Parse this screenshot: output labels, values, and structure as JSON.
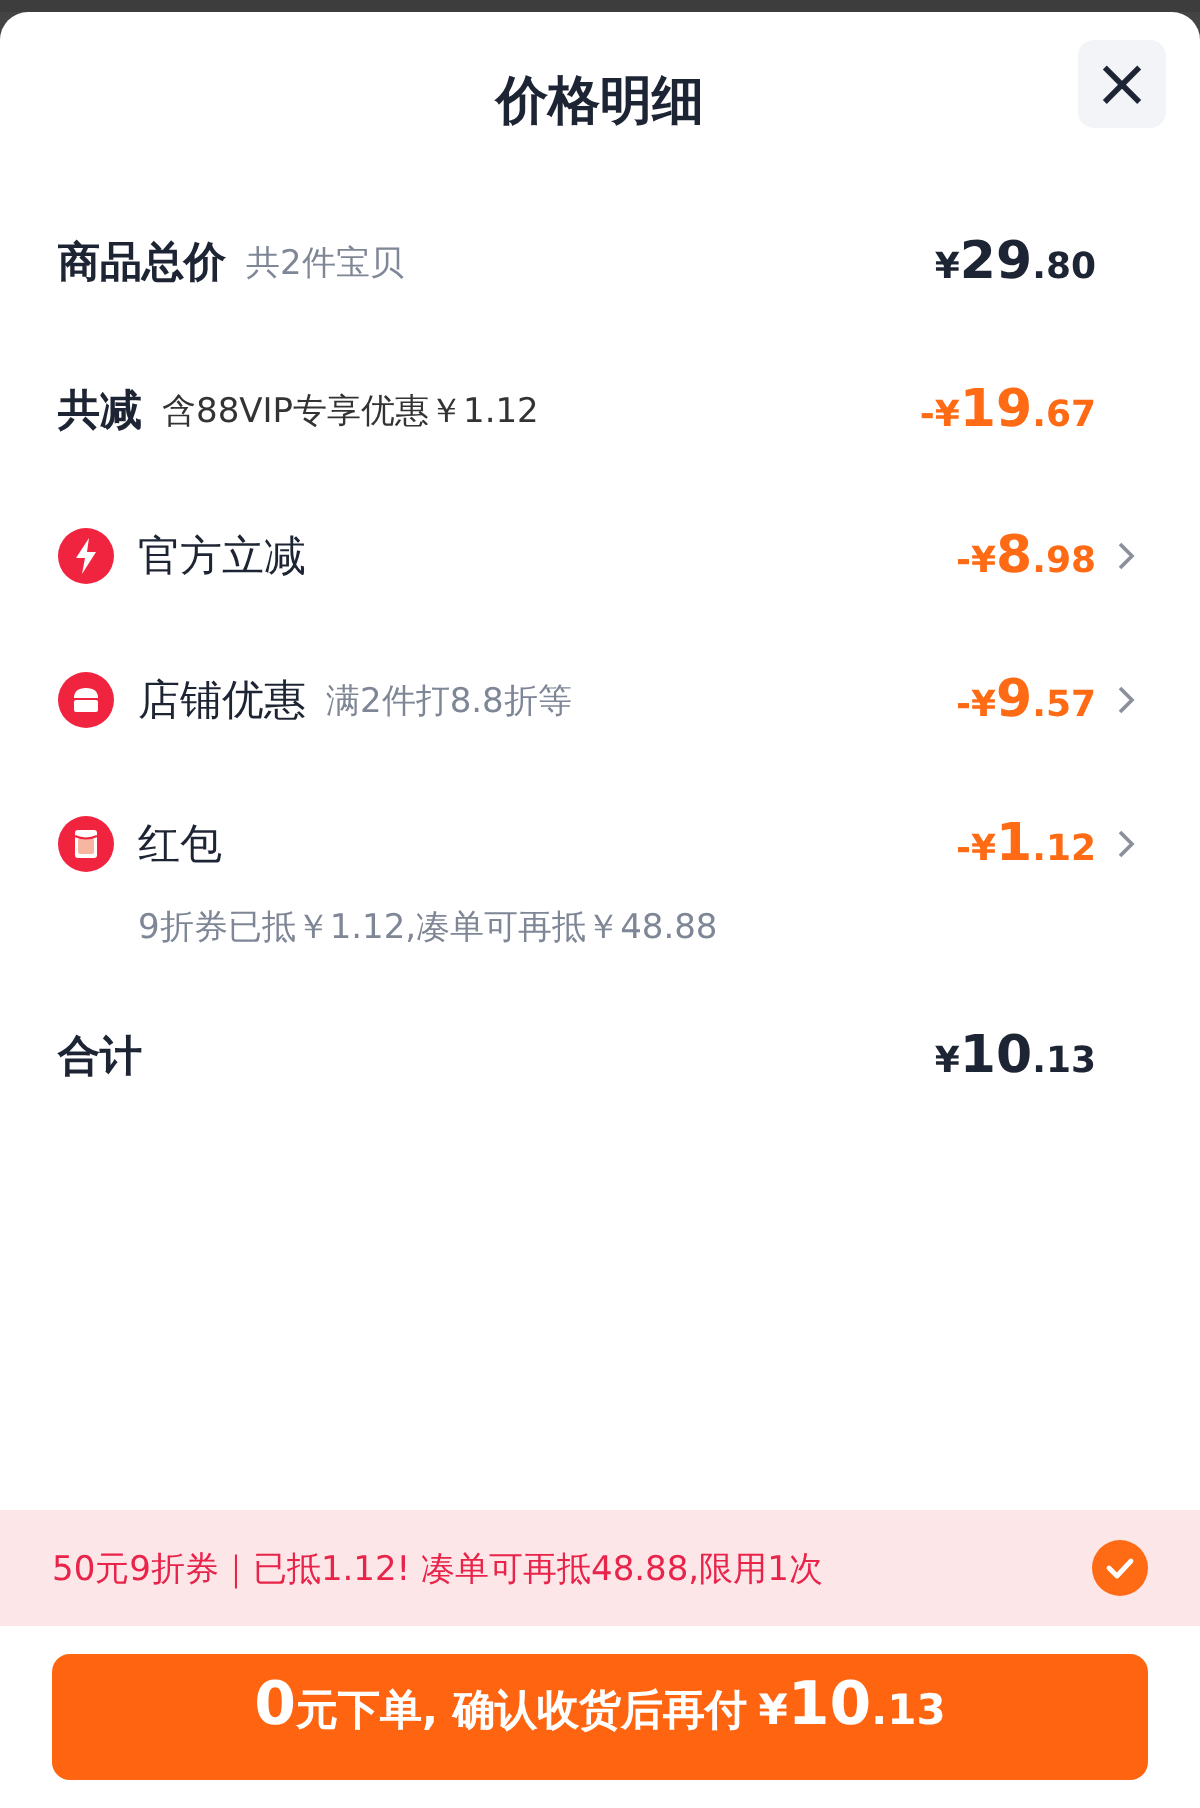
{
  "title": "价格明细",
  "close_label": "×",
  "rows": [
    {
      "kind": "summary",
      "label": "商品总价",
      "note": "共2件宝贝",
      "prefix": "¥",
      "main": "29",
      "decimals": ".80",
      "negative": false,
      "arrow": false
    },
    {
      "kind": "summary",
      "label": "共减",
      "note": "含88VIP专享优惠￥1.12",
      "prefix": "-¥",
      "main": "19",
      "decimals": ".67",
      "negative": true,
      "arrow": false
    },
    {
      "kind": "instant",
      "label": "官方立减",
      "prefix": "-¥",
      "main": "8",
      "decimals": ".98",
      "negative": true,
      "arrow": true
    },
    {
      "kind": "shop",
      "label": "店铺优惠",
      "note": "满2件打8.8折等",
      "prefix": "-¥",
      "main": "9",
      "decimals": ".57",
      "negative": true,
      "arrow": true
    },
    {
      "kind": "packet",
      "label": "红包",
      "sub": "9折券已抵￥1.12,凑单可再抵￥48.88",
      "prefix": "-¥",
      "main": "1",
      "decimals": ".12",
      "negative": true,
      "arrow": true
    },
    {
      "kind": "summary",
      "label": "合计",
      "prefix": "¥",
      "main": "10",
      "decimals": ".13",
      "negative": false,
      "arrow": false
    }
  ],
  "coupon": {
    "text": "50元9折券｜已抵1.12! 凑单可再抵48.88,限用1次",
    "checked": true
  },
  "pay_button": {
    "lead": "0",
    "text": "元下单, 确认收货后再付",
    "prefix": "¥",
    "main": "10",
    "decimals": ".13"
  }
}
